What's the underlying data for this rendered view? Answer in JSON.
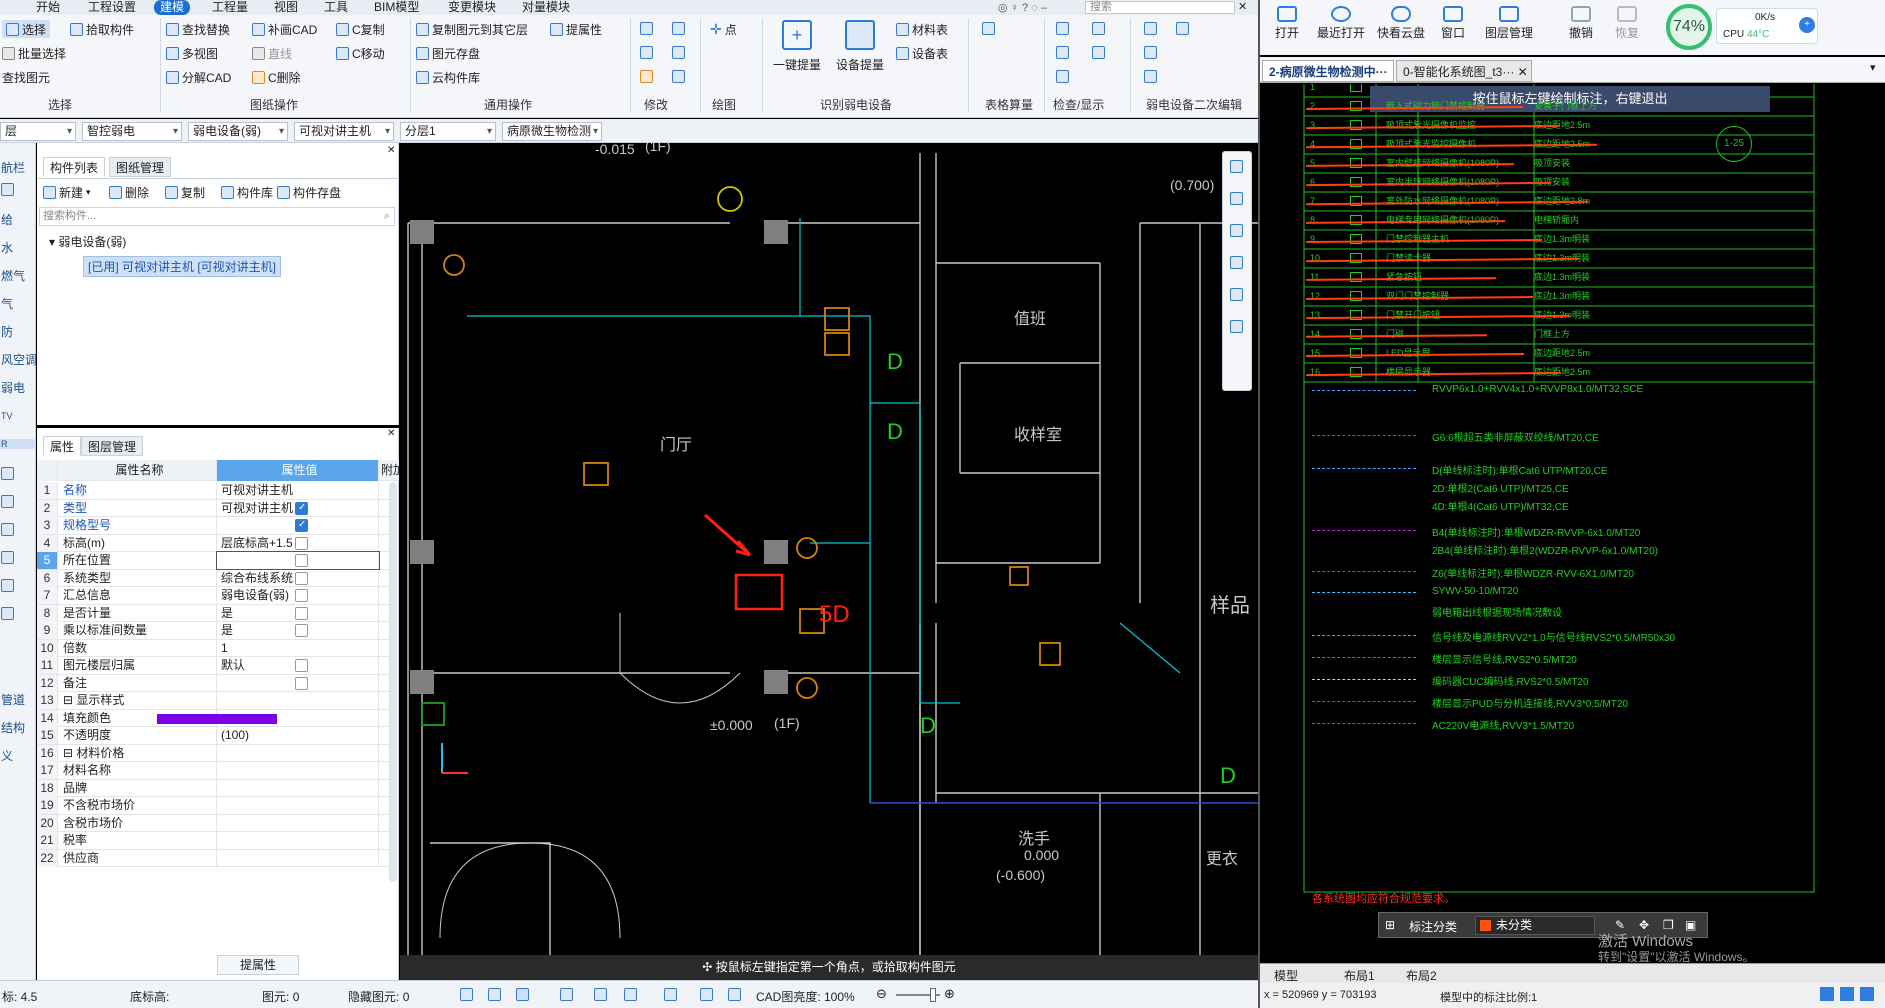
{
  "menu": [
    "开始",
    "工程设置",
    "建模",
    "工程量",
    "视图",
    "工具",
    "BIM模型",
    "变更模块",
    "对量模块"
  ],
  "menu_active": "建模",
  "search_placeholder": "搜索",
  "ribbon": {
    "select_group": {
      "select": "选择",
      "batch_select": "批量选择",
      "find": "查找图元",
      "pick": "拾取构件",
      "label": "选择"
    },
    "draw_group": {
      "find_replace": "查找替换",
      "multi_view": "多视图",
      "split_cad": "分解CAD",
      "add_cad": "补画CAD",
      "line": "直线",
      "c_delete": "C删除",
      "c_copy": "C复制",
      "c_move": "C移动",
      "label": "图纸操作"
    },
    "common_group": {
      "copy_other": "复制图元到其它层",
      "attr": "提属性",
      "store": "图元存盘",
      "cloud": "云构件库",
      "label": "通用操作"
    },
    "modify_label": "修改",
    "draw_label": "绘图",
    "point": "点",
    "identify": {
      "one_key": "一键提量",
      "device": "设备提量",
      "material": "材料表",
      "device_table": "设备表",
      "label": "识别弱电设备"
    },
    "table_calc": "表格算量",
    "check_label": "检查/显示",
    "secondary": "弱电设备二次编辑"
  },
  "filters": [
    "层",
    "智控弱电",
    "弱电设备(弱)",
    "可视对讲主机",
    "分层1",
    "病原微生物检测"
  ],
  "nav_items": [
    "航栏",
    "",
    "给",
    "水",
    "燃气",
    "气",
    "防",
    "风空调",
    "弱电",
    "TV",
    "R",
    "",
    "",
    "",
    "",
    "",
    "",
    "管道",
    "结构",
    "义"
  ],
  "comp_panel": {
    "tab1": "构件列表",
    "tab2": "图纸管理",
    "new": "新建",
    "delete": "删除",
    "copy": "复制",
    "lib": "构件库",
    "store": "构件存盘",
    "search_placeholder": "搜索构件...",
    "tree_root": "弱电设备(弱)",
    "tree_item": "[已用] 可视对讲主机 [可视对讲主机]"
  },
  "prop_panel": {
    "tab1": "属性",
    "tab2": "图层管理",
    "headers": [
      "属性名称",
      "属性值",
      "附加"
    ],
    "rows": [
      {
        "n": "1",
        "name": "名称",
        "val": "可视对讲主机",
        "cb": "none",
        "blue": true
      },
      {
        "n": "2",
        "name": "类型",
        "val": "可视对讲主机",
        "cb": "on",
        "blue": true
      },
      {
        "n": "3",
        "name": "规格型号",
        "val": "",
        "cb": "on",
        "blue": true
      },
      {
        "n": "4",
        "name": "标高(m)",
        "val": "层底标高+1.5",
        "cb": "off",
        "blue": false
      },
      {
        "n": "5",
        "name": "所在位置",
        "val": "",
        "cb": "off",
        "blue": false
      },
      {
        "n": "6",
        "name": "系统类型",
        "val": "综合布线系统",
        "cb": "off",
        "blue": false
      },
      {
        "n": "7",
        "name": "汇总信息",
        "val": "弱电设备(弱)",
        "cb": "off",
        "blue": false
      },
      {
        "n": "8",
        "name": "是否计量",
        "val": "是",
        "cb": "off",
        "blue": false
      },
      {
        "n": "9",
        "name": "乘以标准间数量",
        "val": "是",
        "cb": "off",
        "blue": false
      },
      {
        "n": "10",
        "name": "倍数",
        "val": "1",
        "cb": "none",
        "blue": false
      },
      {
        "n": "11",
        "name": "图元楼层归属",
        "val": "默认",
        "cb": "off",
        "blue": false
      },
      {
        "n": "12",
        "name": "备注",
        "val": "",
        "cb": "off",
        "blue": false
      },
      {
        "n": "13",
        "name": "⊟ 显示样式",
        "val": "",
        "cb": "none",
        "blue": false
      },
      {
        "n": "14",
        "name": "    填充颜色",
        "val": "",
        "cb": "none",
        "blue": false
      },
      {
        "n": "15",
        "name": "    不透明度",
        "val": "(100)",
        "cb": "none",
        "blue": false
      },
      {
        "n": "16",
        "name": "⊟ 材料价格",
        "val": "",
        "cb": "none",
        "blue": false
      },
      {
        "n": "17",
        "name": "    材料名称",
        "val": "",
        "cb": "none",
        "blue": false
      },
      {
        "n": "18",
        "name": "    品牌",
        "val": "",
        "cb": "none",
        "blue": false
      },
      {
        "n": "19",
        "name": "    不含税市场价",
        "val": "",
        "cb": "none",
        "blue": false
      },
      {
        "n": "20",
        "name": "    含税市场价",
        "val": "",
        "cb": "none",
        "blue": false
      },
      {
        "n": "21",
        "name": "    税率",
        "val": "",
        "cb": "none",
        "blue": false
      },
      {
        "n": "22",
        "name": "    供应商",
        "val": "",
        "cb": "none",
        "blue": false
      }
    ],
    "fill_color": "#7a00e6",
    "btn_attr": "提属性"
  },
  "status": {
    "level": "4.5",
    "floor_label": "底标高:",
    "elem_label": "图元:",
    "elem_val": "0",
    "hidden_label": "隐藏图元:",
    "hidden_val": "0",
    "cad_brightness": "CAD图亮度: 100%"
  },
  "canvas": {
    "hint": "按鼠标左键指定第一个角点，或拾取构件图元",
    "labels": [
      "-0.015",
      "(1F)",
      "(0.700)",
      "值班",
      "门厅",
      "收样室",
      "样品",
      "±0.000",
      "(1F)",
      "洗手",
      "0.000",
      "(-0.600)",
      "更衣",
      "5D"
    ],
    "d_labels": [
      "D",
      "D",
      "D",
      "D"
    ]
  },
  "right": {
    "toolbar": [
      "打开",
      "最近打开",
      "快看云盘",
      "窗口",
      "图层管理",
      "撤销",
      "恢复"
    ],
    "cpu_pct": "74%",
    "net": "0K/s",
    "cpu_label": "CPU",
    "cpu_temp": "44°C",
    "tabs": [
      "2-病原微生物检测中···",
      "0-智能化系统图_t3···"
    ],
    "banner": "按住鼠标左键绘制标注，右键退出",
    "legend_nums": [
      "1",
      "2",
      "3",
      "4",
      "5",
      "6",
      "7",
      "8",
      "9",
      "10",
      "11",
      "12",
      "13",
      "14",
      "15",
      "16"
    ],
    "legend_names": [
      "",
      "嵌入式磁力锁门禁控制器",
      "吸顶式紫光摄像机监控",
      "吸顶式紫光监控摄像机",
      "室内壁挂网络摄像机(1080P)",
      "室内半球网络摄像机(1080P)",
      "室外防水网络摄像机(1080P)",
      "电梯专用网络摄像机(1080P)",
      "门禁控制器主机",
      "门禁读卡器",
      "紧急按钮",
      "双门门禁控制器",
      "门禁开门按钮",
      "门磁",
      "LED显示屏",
      "楼层显示器"
    ],
    "legend_specs": [
      "",
      "安装于门框上方",
      "底边距地2.5m",
      "底边距地2.5m",
      "吸顶安装",
      "吸顶安装",
      "底边距地2.8m",
      "电梯轿厢内",
      "底边1.3m明装",
      "底边1.3m明装",
      "底边1.3m明装",
      "底边1.3m明装",
      "底边1.3m明装",
      "门框上方",
      "底边距地2.5m",
      "底边距地2.5m"
    ],
    "circle_label": "1-25",
    "cable_specs": [
      "RVVP6x1.0+RVV4x1.0+RVVP8x1.0/MT32,SCE",
      "G6:6根超五类非屏蔽双绞线/MT20,CE",
      "D(单线标注时):单根Cat6 UTP/MT20,CE",
      "2D:单根2(Cat6 UTP)/MT25,CE",
      "4D:单根4(Cat6 UTP)/MT32,CE",
      "B4(单线标注时):单根WDZR-RVVP-6x1.0/MT20",
      "2B4(单线标注时):单根2(WDZR-RVVP-6x1.0/MT20)",
      "Z6(单线标注时):单根WDZR-RVV-6X1.0/MT20",
      "SYWV-50-10/MT20",
      "弱电箱出线根据现场情况敷设",
      "信号线及电源线RVV2*1.0与信号线RVS2*0.5/MR50x30",
      "楼层显示信号线,RVS2*0.5/MT20",
      "编码器CUC编码线,RVS2*0.5/MT20",
      "楼层显示PUD与分机连接线,RVV3*0.5/MT20",
      "AC220V电源线,RVV3*1.5/MT20"
    ],
    "footer_note": "各系统图均应符合规范要求。",
    "anno_label": "标注分类",
    "anno_value": "未分类",
    "bottom_tabs": [
      "模型",
      "布局1",
      "布局2"
    ],
    "coords": "x = 520969  y = 703193",
    "scale": "模型中的标注比例:1",
    "watermark": "激活 Windows",
    "watermark2": "转到\"设置\"以激活 Windows。"
  }
}
